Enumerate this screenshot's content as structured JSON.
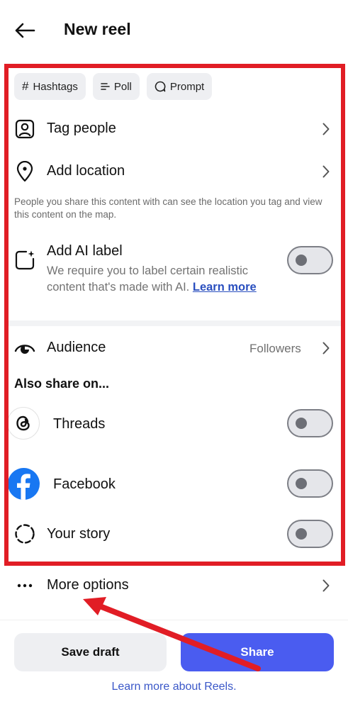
{
  "header": {
    "title": "New reel"
  },
  "pills": [
    {
      "label": "Hashtags",
      "icon": "hashtag-icon"
    },
    {
      "label": "Poll",
      "icon": "poll-icon"
    },
    {
      "label": "Prompt",
      "icon": "prompt-icon"
    }
  ],
  "rows": {
    "tag_people": "Tag people",
    "add_location": "Add location",
    "location_note": "People you share this content with can see the location you tag and view this content on the map.",
    "ai_label_title": "Add AI label",
    "ai_label_desc": "We require you to label certain realistic content that's made with AI.",
    "ai_label_link": "Learn more",
    "audience": "Audience",
    "audience_value": "Followers",
    "also_share": "Also share on...",
    "threads": "Threads",
    "facebook": "Facebook",
    "your_story": "Your story",
    "more_options": "More options"
  },
  "toggles": {
    "ai_label": false,
    "threads": false,
    "facebook": false,
    "your_story": false
  },
  "footer": {
    "save_draft": "Save draft",
    "share": "Share",
    "learn_more": "Learn more about Reels."
  },
  "colors": {
    "accent": "#4a5cf0",
    "annotation": "#e11d25",
    "facebook": "#1877f2",
    "link": "#2a4fbf"
  }
}
